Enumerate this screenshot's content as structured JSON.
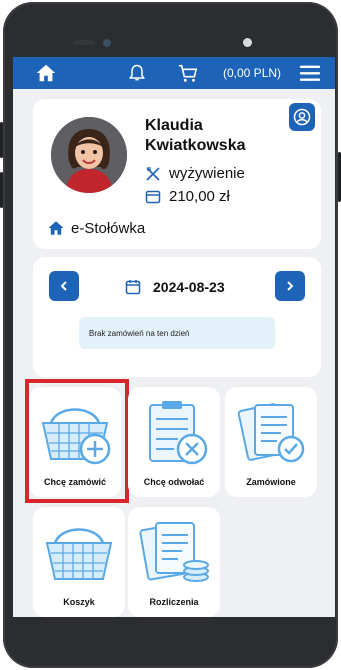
{
  "navbar": {
    "amount": "(0,00 PLN)",
    "icons": [
      "home-icon",
      "bell-icon",
      "cart-icon",
      "menu-icon"
    ]
  },
  "profile": {
    "first_name": "Klaudia",
    "last_name": "Kwiatkowska",
    "meal_plan": "wyżywienie",
    "balance": "210,00 zł",
    "org": "e-Stołówka"
  },
  "date_picker": {
    "date": "2024-08-23",
    "empty_message": "Brak zamówień na ten dzień"
  },
  "tiles": [
    {
      "label": "Chcę zamówić"
    },
    {
      "label": "Chcę odwołać"
    },
    {
      "label": "Zamówione"
    },
    {
      "label": "Koszyk"
    },
    {
      "label": "Rozliczenia"
    }
  ],
  "colors": {
    "primary": "#1d63b8",
    "highlight": "#d7262c",
    "icon_blue": "#5aa9e6"
  }
}
